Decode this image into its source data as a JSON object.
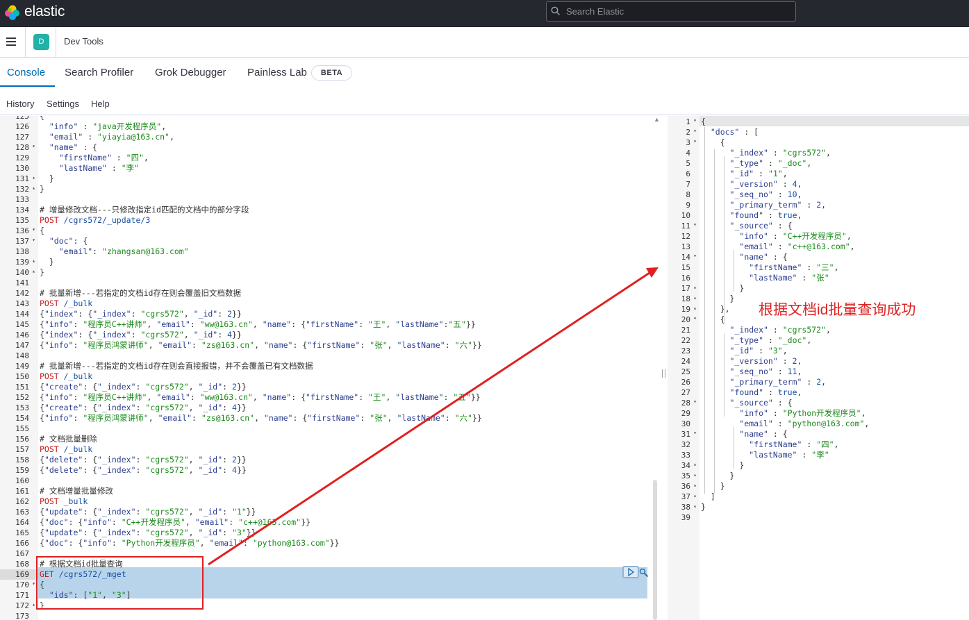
{
  "header": {
    "brand": "elastic",
    "search_placeholder": "Search Elastic",
    "avatar_initial": "D",
    "breadcrumb": "Dev Tools"
  },
  "tabs": [
    {
      "label": "Console",
      "active": true
    },
    {
      "label": "Search Profiler",
      "active": false
    },
    {
      "label": "Grok Debugger",
      "active": false
    },
    {
      "label": "Painless Lab",
      "active": false
    }
  ],
  "beta_badge": "BETA",
  "submenu": {
    "history": "History",
    "settings": "Settings",
    "help": "Help"
  },
  "colors": {
    "accent": "#006bb8",
    "header_bg": "#25282f",
    "annotation": "#e02020",
    "selection": "#b7d4ea"
  },
  "input_lines": [
    {
      "n": "125",
      "fold": "",
      "text": "{"
    },
    {
      "n": "126",
      "fold": "",
      "text": "  \"info\" : \"java开发程序员\","
    },
    {
      "n": "127",
      "fold": "",
      "text": "  \"email\" : \"yiayia@163.cn\","
    },
    {
      "n": "128",
      "fold": "▾",
      "text": "  \"name\" : {"
    },
    {
      "n": "129",
      "fold": "",
      "text": "    \"firstName\" : \"四\","
    },
    {
      "n": "130",
      "fold": "",
      "text": "    \"lastName\" : \"李\""
    },
    {
      "n": "131",
      "fold": "▴",
      "text": "  }"
    },
    {
      "n": "132",
      "fold": "▴",
      "text": "}"
    },
    {
      "n": "133",
      "fold": "",
      "text": ""
    },
    {
      "n": "134",
      "fold": "",
      "text": "# 增量修改文档---只修改指定id匹配的文档中的部分字段"
    },
    {
      "n": "135",
      "fold": "",
      "text": "POST /cgrs572/_update/3"
    },
    {
      "n": "136",
      "fold": "▾",
      "text": "{"
    },
    {
      "n": "137",
      "fold": "▾",
      "text": "  \"doc\": {"
    },
    {
      "n": "138",
      "fold": "",
      "text": "    \"email\": \"zhangsan@163.com\""
    },
    {
      "n": "139",
      "fold": "▴",
      "text": "  }"
    },
    {
      "n": "140",
      "fold": "▴",
      "text": "}"
    },
    {
      "n": "141",
      "fold": "",
      "text": ""
    },
    {
      "n": "142",
      "fold": "",
      "text": "# 批量新增---若指定的文档id存在则会覆盖旧文档数据"
    },
    {
      "n": "143",
      "fold": "",
      "text": "POST /_bulk"
    },
    {
      "n": "144",
      "fold": "",
      "text": "{\"index\": {\"_index\": \"cgrs572\", \"_id\": 2}}"
    },
    {
      "n": "145",
      "fold": "",
      "text": "{\"info\": \"程序员C++讲师\", \"email\": \"ww@163.cn\", \"name\": {\"firstName\": \"王\", \"lastName\":\"五\"}}"
    },
    {
      "n": "146",
      "fold": "",
      "text": "{\"index\": {\"_index\": \"cgrs572\", \"_id\": 4}}"
    },
    {
      "n": "147",
      "fold": "",
      "text": "{\"info\": \"程序员鸿蒙讲师\", \"email\": \"zs@163.cn\", \"name\": {\"firstName\": \"张\", \"lastName\": \"六\"}}"
    },
    {
      "n": "148",
      "fold": "",
      "text": ""
    },
    {
      "n": "149",
      "fold": "",
      "text": "# 批量新增---若指定的文档id存在则会直接报错，并不会覆盖已有文档数据"
    },
    {
      "n": "150",
      "fold": "",
      "text": "POST /_bulk"
    },
    {
      "n": "151",
      "fold": "",
      "text": "{\"create\": {\"_index\": \"cgrs572\", \"_id\": 2}}"
    },
    {
      "n": "152",
      "fold": "",
      "text": "{\"info\": \"程序员C++讲师\", \"email\": \"ww@163.cn\", \"name\": {\"firstName\": \"王\", \"lastName\": \"五\"}}"
    },
    {
      "n": "153",
      "fold": "",
      "text": "{\"create\": {\"_index\": \"cgrs572\", \"_id\": 4}}"
    },
    {
      "n": "154",
      "fold": "",
      "text": "{\"info\": \"程序员鸿蒙讲师\", \"email\": \"zs@163.cn\", \"name\": {\"firstName\": \"张\", \"lastName\": \"六\"}}"
    },
    {
      "n": "155",
      "fold": "",
      "text": ""
    },
    {
      "n": "156",
      "fold": "",
      "text": "# 文档批量删除"
    },
    {
      "n": "157",
      "fold": "",
      "text": "POST /_bulk"
    },
    {
      "n": "158",
      "fold": "",
      "text": "{\"delete\": {\"_index\": \"cgrs572\", \"_id\": 2}}"
    },
    {
      "n": "159",
      "fold": "",
      "text": "{\"delete\": {\"_index\": \"cgrs572\", \"_id\": 4}}"
    },
    {
      "n": "160",
      "fold": "",
      "text": ""
    },
    {
      "n": "161",
      "fold": "",
      "text": "# 文档增量批量修改"
    },
    {
      "n": "162",
      "fold": "",
      "text": "POST _bulk"
    },
    {
      "n": "163",
      "fold": "",
      "text": "{\"update\": {\"_index\": \"cgrs572\", \"_id\": \"1\"}}"
    },
    {
      "n": "164",
      "fold": "",
      "text": "{\"doc\": {\"info\": \"C++开发程序员\", \"email\": \"c++@163.com\"}}"
    },
    {
      "n": "165",
      "fold": "",
      "text": "{\"update\": {\"_index\": \"cgrs572\", \"_id\": \"3\"}}"
    },
    {
      "n": "166",
      "fold": "",
      "text": "{\"doc\": {\"info\": \"Python开发程序员\", \"email\": \"python@163.com\"}}"
    },
    {
      "n": "167",
      "fold": "",
      "text": ""
    },
    {
      "n": "168",
      "fold": "",
      "text": "# 根据文档id批量查询"
    },
    {
      "n": "169",
      "fold": "",
      "text": "GET /cgrs572/_mget"
    },
    {
      "n": "170",
      "fold": "▾",
      "text": "{"
    },
    {
      "n": "171",
      "fold": "",
      "text": "  \"ids\": [\"1\", \"3\"]"
    },
    {
      "n": "172",
      "fold": "▴",
      "text": "}"
    },
    {
      "n": "173",
      "fold": "",
      "text": ""
    }
  ],
  "output_lines": [
    {
      "n": "1",
      "fold": "▾",
      "text": "{"
    },
    {
      "n": "2",
      "fold": "▾",
      "text": "  \"docs\" : ["
    },
    {
      "n": "3",
      "fold": "▾",
      "text": "    {"
    },
    {
      "n": "4",
      "fold": "",
      "text": "      \"_index\" : \"cgrs572\","
    },
    {
      "n": "5",
      "fold": "",
      "text": "      \"_type\" : \"_doc\","
    },
    {
      "n": "6",
      "fold": "",
      "text": "      \"_id\" : \"1\","
    },
    {
      "n": "7",
      "fold": "",
      "text": "      \"_version\" : 4,"
    },
    {
      "n": "8",
      "fold": "",
      "text": "      \"_seq_no\" : 10,"
    },
    {
      "n": "9",
      "fold": "",
      "text": "      \"_primary_term\" : 2,"
    },
    {
      "n": "10",
      "fold": "",
      "text": "      \"found\" : true,"
    },
    {
      "n": "11",
      "fold": "▾",
      "text": "      \"_source\" : {"
    },
    {
      "n": "12",
      "fold": "",
      "text": "        \"info\" : \"C++开发程序员\","
    },
    {
      "n": "13",
      "fold": "",
      "text": "        \"email\" : \"c++@163.com\","
    },
    {
      "n": "14",
      "fold": "▾",
      "text": "        \"name\" : {"
    },
    {
      "n": "15",
      "fold": "",
      "text": "          \"firstName\" : \"三\","
    },
    {
      "n": "16",
      "fold": "",
      "text": "          \"lastName\" : \"张\""
    },
    {
      "n": "17",
      "fold": "▴",
      "text": "        }"
    },
    {
      "n": "18",
      "fold": "▴",
      "text": "      }"
    },
    {
      "n": "19",
      "fold": "▴",
      "text": "    },"
    },
    {
      "n": "20",
      "fold": "▾",
      "text": "    {"
    },
    {
      "n": "21",
      "fold": "",
      "text": "      \"_index\" : \"cgrs572\","
    },
    {
      "n": "22",
      "fold": "",
      "text": "      \"_type\" : \"_doc\","
    },
    {
      "n": "23",
      "fold": "",
      "text": "      \"_id\" : \"3\","
    },
    {
      "n": "24",
      "fold": "",
      "text": "      \"_version\" : 2,"
    },
    {
      "n": "25",
      "fold": "",
      "text": "      \"_seq_no\" : 11,"
    },
    {
      "n": "26",
      "fold": "",
      "text": "      \"_primary_term\" : 2,"
    },
    {
      "n": "27",
      "fold": "",
      "text": "      \"found\" : true,"
    },
    {
      "n": "28",
      "fold": "▾",
      "text": "      \"_source\" : {"
    },
    {
      "n": "29",
      "fold": "",
      "text": "        \"info\" : \"Python开发程序员\","
    },
    {
      "n": "30",
      "fold": "",
      "text": "        \"email\" : \"python@163.com\","
    },
    {
      "n": "31",
      "fold": "▾",
      "text": "        \"name\" : {"
    },
    {
      "n": "32",
      "fold": "",
      "text": "          \"firstName\" : \"四\","
    },
    {
      "n": "33",
      "fold": "",
      "text": "          \"lastName\" : \"李\""
    },
    {
      "n": "34",
      "fold": "▴",
      "text": "        }"
    },
    {
      "n": "35",
      "fold": "▴",
      "text": "      }"
    },
    {
      "n": "36",
      "fold": "▴",
      "text": "    }"
    },
    {
      "n": "37",
      "fold": "▴",
      "text": "  ]"
    },
    {
      "n": "38",
      "fold": "▴",
      "text": "}"
    },
    {
      "n": "39",
      "fold": "",
      "text": ""
    }
  ],
  "annotation": {
    "text": "根据文档id批量查询成功"
  }
}
